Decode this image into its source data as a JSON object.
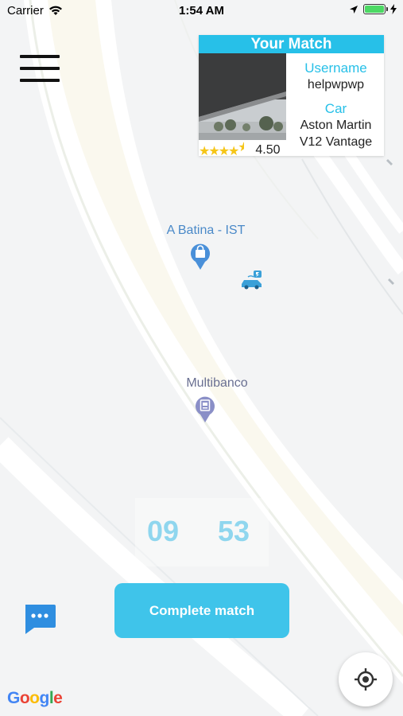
{
  "status_bar": {
    "carrier": "Carrier",
    "time": "1:54 AM"
  },
  "menu": {
    "icon": "hamburger-menu-icon"
  },
  "match_card": {
    "title": "Your Match",
    "username_label": "Username",
    "username": "helpwpwp",
    "car_label": "Car",
    "car_line1": "Aston Martin",
    "car_line2": "V12 Vantage",
    "rating": "4.50",
    "rating_stars": 4.5
  },
  "map": {
    "poi_1": "A Batina - IST",
    "poi_2": "Multibanco"
  },
  "timer": {
    "minutes": "09",
    "seconds": "53"
  },
  "actions": {
    "complete_label": "Complete match"
  },
  "branding": {
    "google": "Google"
  },
  "colors": {
    "accent": "#27c0e8",
    "button": "#3fc4ea",
    "timer_text": "#8fd6ee",
    "star": "#f5c518"
  }
}
